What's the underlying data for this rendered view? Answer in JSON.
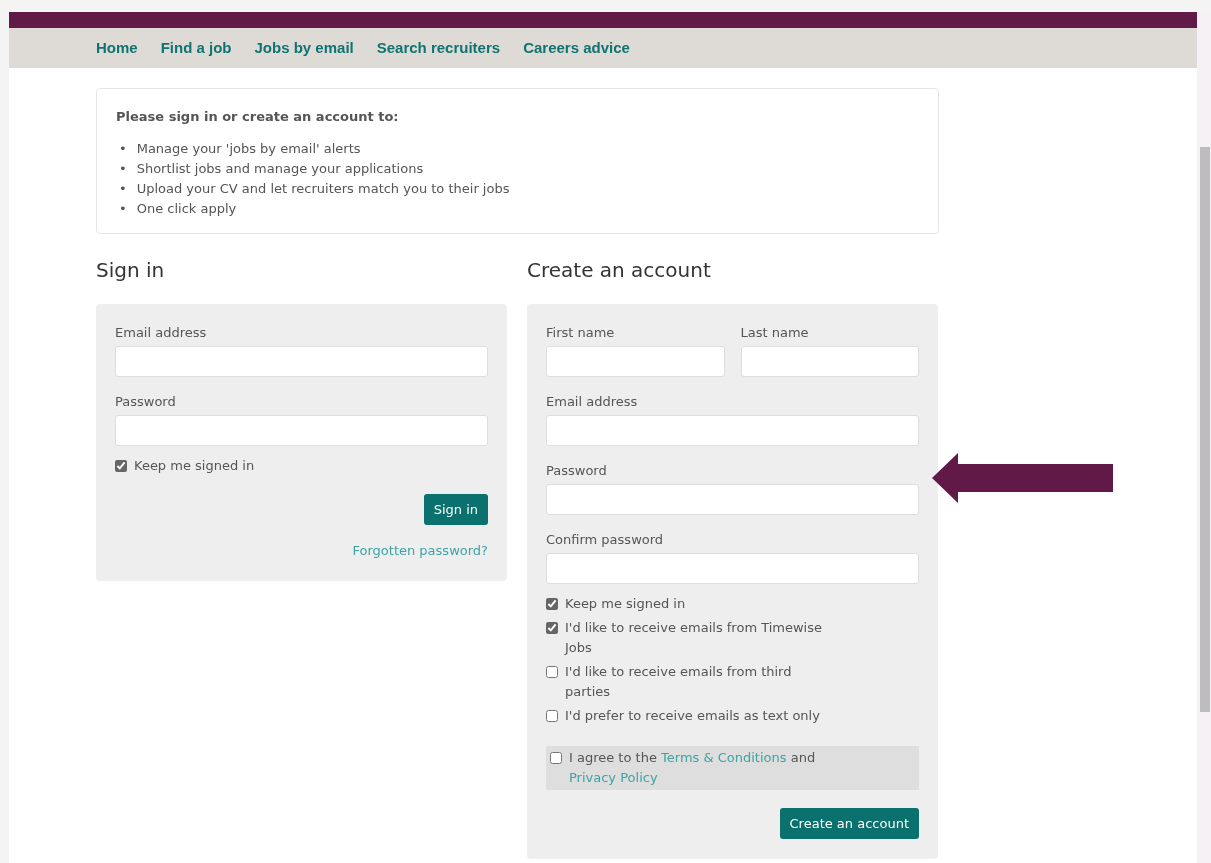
{
  "nav": [
    {
      "label": "Home"
    },
    {
      "label": "Find a job"
    },
    {
      "label": "Jobs by email"
    },
    {
      "label": "Search recruiters"
    },
    {
      "label": "Careers advice"
    }
  ],
  "intro": {
    "title": "Please sign in or create an account to:",
    "items": [
      {
        "marker": "•",
        "text": "Manage your 'jobs by email' alerts"
      },
      {
        "marker": "•",
        "text": "Shortlist jobs and manage your applications"
      },
      {
        "marker": "•",
        "text": "Upload your CV and let recruiters match you to their jobs"
      },
      {
        "marker": "•",
        "text": "One click apply"
      }
    ]
  },
  "sign_in": {
    "heading": "Sign in",
    "fields": [
      {
        "label": "Email address"
      },
      {
        "label": "Password"
      }
    ],
    "checkboxes": [
      {
        "label": "Keep me signed in",
        "checked": true
      }
    ],
    "button": "Sign in",
    "link": "Forgotten password?"
  },
  "create_account": {
    "heading": "Create an account",
    "name_fields": [
      {
        "label": "First name"
      },
      {
        "label": "Last name"
      }
    ],
    "fields": [
      {
        "label": "Email address"
      },
      {
        "label": "Password"
      },
      {
        "label": "Confirm password"
      }
    ],
    "checkboxes": [
      {
        "label": "Keep me signed in",
        "checked": true
      },
      {
        "label": "I'd like to receive emails from Timewise Jobs",
        "checked": true
      },
      {
        "label": "I'd like to receive emails from third parties",
        "checked": false
      },
      {
        "label": "I'd prefer to receive emails as text only",
        "checked": false
      }
    ],
    "agree": {
      "checked": false,
      "parts": [
        {
          "kind": "text",
          "text": "I agree to the"
        },
        {
          "kind": "link",
          "text": "Terms & Conditions"
        },
        {
          "kind": "text",
          "text": "and"
        },
        {
          "kind": "link",
          "text": "Privacy Policy"
        }
      ]
    },
    "button": "Create an account"
  }
}
